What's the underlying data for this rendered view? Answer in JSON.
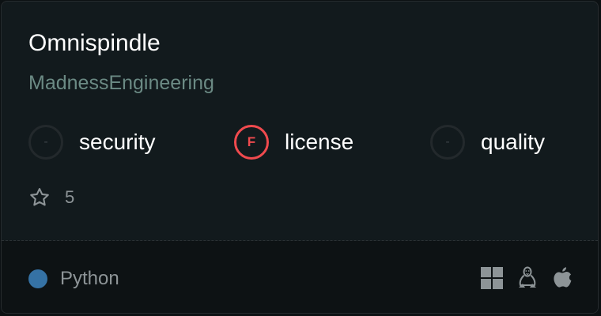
{
  "repo": {
    "name": "Omnispindle",
    "owner": "MadnessEngineering"
  },
  "metrics": [
    {
      "grade": "-",
      "label": "security",
      "status": "none"
    },
    {
      "grade": "F",
      "label": "license",
      "status": "fail",
      "color": "#f04a4e"
    },
    {
      "grade": "-",
      "label": "quality",
      "status": "none"
    }
  ],
  "stars": {
    "icon": "star-icon",
    "count": "5"
  },
  "footer": {
    "language": {
      "name": "Python",
      "color": "#3572a5"
    },
    "platforms": [
      "windows-icon",
      "linux-icon",
      "apple-icon"
    ]
  }
}
